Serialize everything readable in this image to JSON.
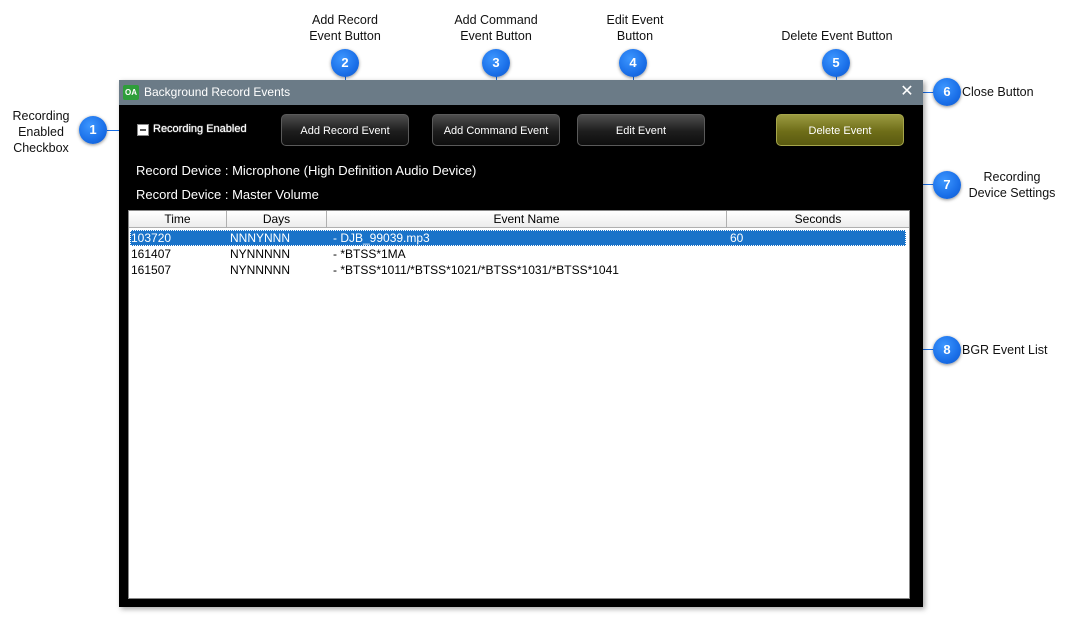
{
  "callouts": [
    {
      "num": "1",
      "label": "Recording Enabled Checkbox"
    },
    {
      "num": "2",
      "label": "Add Record Event Button"
    },
    {
      "num": "3",
      "label": "Add Command Event Button"
    },
    {
      "num": "4",
      "label": "Edit Event Button"
    },
    {
      "num": "5",
      "label": "Delete Event Button"
    },
    {
      "num": "6",
      "label": "Close Button"
    },
    {
      "num": "7",
      "label": "Recording Device Settings"
    },
    {
      "num": "8",
      "label": "BGR Event List"
    }
  ],
  "callout_lines": {
    "c1": [
      "Recording",
      "Enabled",
      "Checkbox"
    ],
    "c2": [
      "Add Record",
      "Event Button"
    ],
    "c3": [
      "Add Command",
      "Event Button"
    ],
    "c4": [
      "Edit Event",
      "Button"
    ],
    "c5": [
      "Delete Event Button"
    ],
    "c6": [
      "Close Button"
    ],
    "c7": [
      "Recording",
      "Device Settings"
    ],
    "c8": [
      "BGR Event List"
    ]
  },
  "window": {
    "app_icon": "OA",
    "title": "Background Record Events",
    "close_icon": "close-icon"
  },
  "toolbar": {
    "recording_enabled_label": "Recording Enabled",
    "recording_enabled_checked": false,
    "add_record_label": "Add Record Event",
    "add_command_label": "Add Command Event",
    "edit_label": "Edit Event",
    "delete_label": "Delete Event"
  },
  "devices": [
    "Record Device : Microphone (High Definition Audio Device)",
    "Record Device : Master Volume"
  ],
  "event_list": {
    "columns": [
      "Time",
      "Days",
      "Event Name",
      "Seconds"
    ],
    "rows": [
      {
        "time": "103720",
        "days": "NNNYNNN",
        "event_name": "- DJB_99039.mp3",
        "seconds": "60",
        "selected": true
      },
      {
        "time": "161407",
        "days": "NYNNNNN",
        "event_name": "- *BTSS*1MA",
        "seconds": "",
        "selected": false
      },
      {
        "time": "161507",
        "days": "NYNNNNN",
        "event_name": "- *BTSS*1011/*BTSS*1021/*BTSS*1031/*BTSS*1041",
        "seconds": "",
        "selected": false
      }
    ]
  },
  "colors": {
    "badge": "#1a6fe8",
    "titlebar": "#6b7b87",
    "selection": "#1a73c9",
    "delete_button": "#6e6d18"
  }
}
